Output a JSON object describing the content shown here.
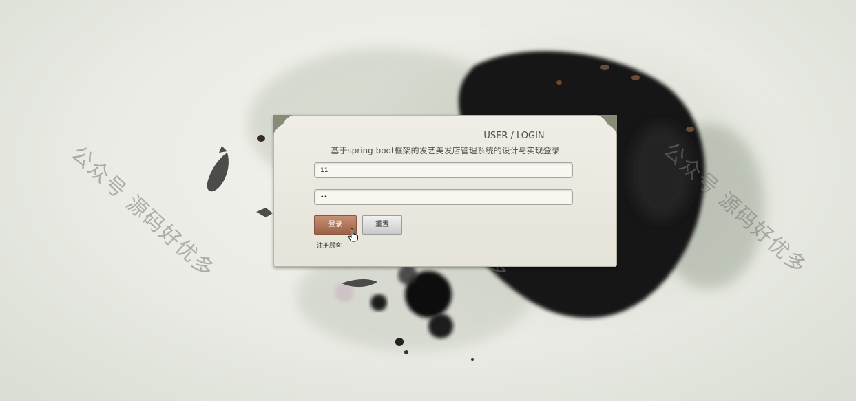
{
  "login": {
    "heading": "USER / LOGIN",
    "system_title": "基于spring boot框架的发艺美发店管理系统的设计与实现登录",
    "username_value": "11",
    "password_value": "••",
    "login_button": "登录",
    "reset_button": "重置",
    "register_link": "注册顾客"
  },
  "watermark": {
    "text": "公众号 源码好优多"
  },
  "colors": {
    "login_button": "#b27a60",
    "ink": "#1a1a1a",
    "panel": "#ebe8df"
  }
}
